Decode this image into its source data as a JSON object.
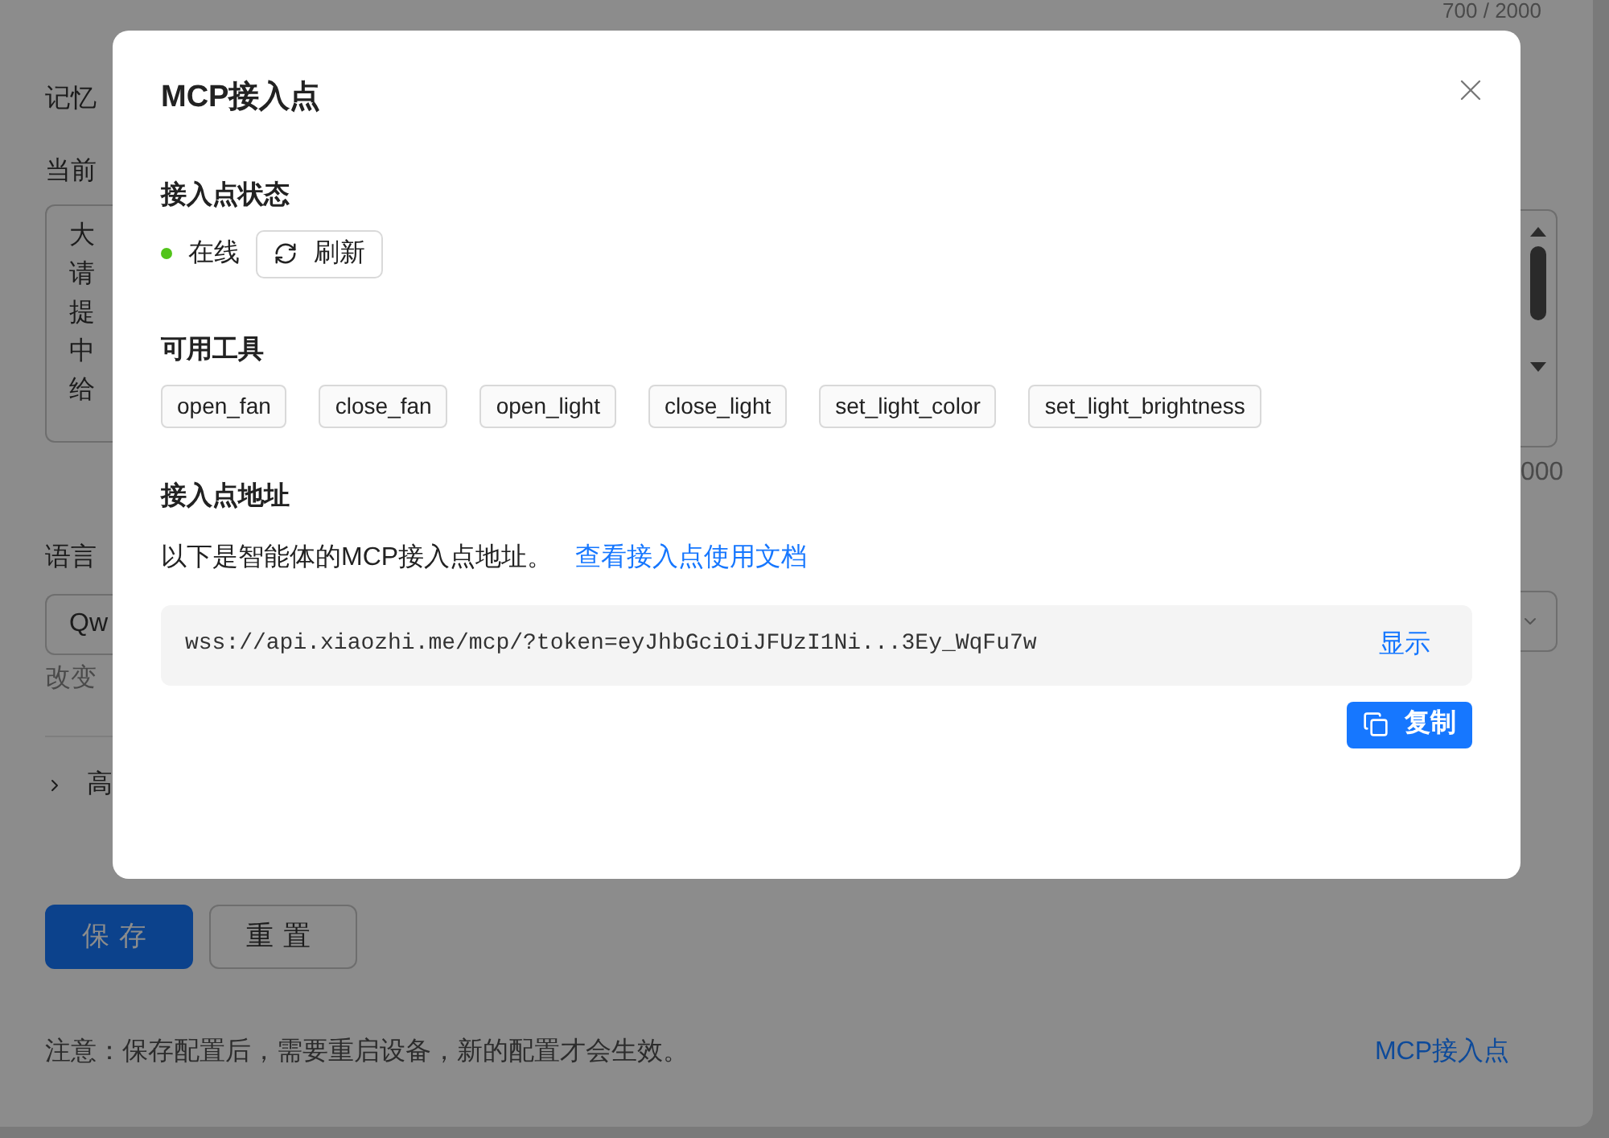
{
  "page": {
    "counter_top": "700 / 2000",
    "memory_label": "记忆",
    "prompt_label": "当前",
    "prompt_lines": [
      "大",
      "请",
      "提",
      "中",
      "给"
    ],
    "prompt_counter": "000",
    "language_label": "语言",
    "language_value": "Qw",
    "language_hint": "改变",
    "advanced_label": "高",
    "advanced_expanded": false,
    "buttons": [
      {
        "label": "保存",
        "kind": "primary"
      },
      {
        "label": "重置",
        "kind": "default"
      }
    ],
    "note": "注意：保存配置后，需要重启设备，新的配置才会生效。",
    "mcp_link": "MCP接入点"
  },
  "dialog": {
    "title": "MCP接入点",
    "status_heading": "接入点状态",
    "status": {
      "label": "在线",
      "online": true
    },
    "refresh_button": "刷新",
    "tools_heading": "可用工具",
    "tools": [
      "open_fan",
      "close_fan",
      "open_light",
      "close_light",
      "set_light_color",
      "set_light_brightness"
    ],
    "address_heading": "接入点地址",
    "address_description": "以下是智能体的MCP接入点地址。",
    "docs_link": "查看接入点使用文档",
    "address": "wss://api.xiaozhi.me/mcp/?token=eyJhbGciOiJFUzI1Ni...3Ey_WqFu7w",
    "show_button": "显示",
    "copy_button": "复制"
  }
}
